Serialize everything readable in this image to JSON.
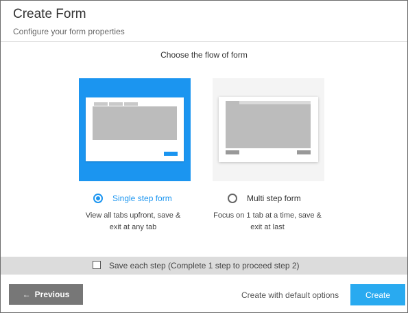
{
  "dialog": {
    "title": "Create Form",
    "subtitle": "Configure your form properties"
  },
  "flow": {
    "heading": "Choose the flow of form",
    "options": [
      {
        "label": "Single step form",
        "description_line1": "View all tabs upfront, save &",
        "description_line2": "exit at any tab",
        "selected": true
      },
      {
        "label": "Multi step form",
        "description_line1": "Focus on 1 tab at a time, save &",
        "description_line2": "exit at last",
        "selected": false
      }
    ]
  },
  "save_each_step": {
    "label": "Save each step (Complete 1 step to proceed step 2)",
    "checked": false
  },
  "footer": {
    "previous_arrow": "←",
    "previous_label": "Previous",
    "default_options_label": "Create with default options",
    "create_label": "Create"
  },
  "colors": {
    "accent": "#1b95f0",
    "create_button": "#29aaf0",
    "previous_button": "#777777"
  }
}
